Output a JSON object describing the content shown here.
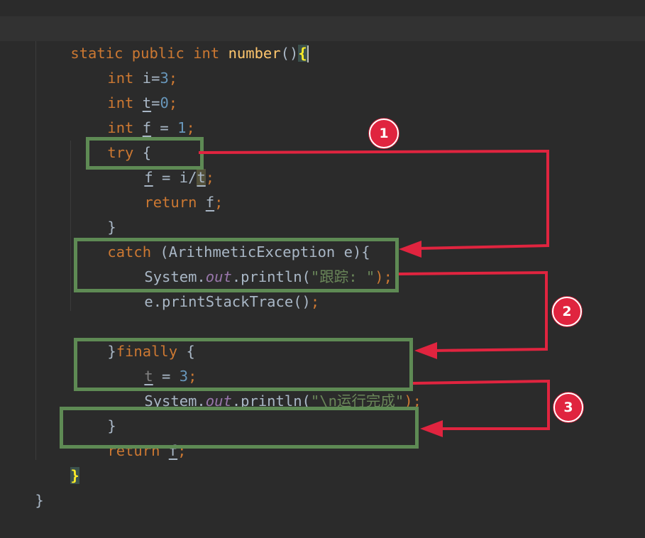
{
  "editor": {
    "language": "java",
    "lines": [
      {
        "parts": [
          "static",
          "public",
          "int",
          "number",
          "()",
          "{"
        ]
      },
      {
        "parts": [
          "int",
          "i=",
          "3",
          ";"
        ]
      },
      {
        "parts": [
          "int",
          "t",
          "=",
          "0",
          ";"
        ]
      },
      {
        "parts": [
          "int",
          "f",
          " = ",
          "1",
          ";"
        ]
      },
      {
        "parts": [
          "try",
          " {"
        ]
      },
      {
        "parts": [
          "f",
          " = i/",
          "t",
          ";"
        ]
      },
      {
        "parts": [
          "return",
          "f",
          ";"
        ]
      },
      {
        "parts": [
          "}"
        ]
      },
      {
        "parts": [
          "catch",
          " (ArithmeticException e){"
        ]
      },
      {
        "parts": [
          "System.",
          "out",
          ".println(",
          "\"跟踪: \"",
          ");"
        ]
      },
      {
        "parts": [
          "e.printStackTrace()",
          ";"
        ]
      },
      {
        "parts": [
          "}",
          "finally",
          " {"
        ]
      },
      {
        "parts": [
          "t",
          " = ",
          "3",
          ";"
        ]
      },
      {
        "parts": [
          "System.",
          "out",
          ".println(",
          "\"\\n运行完成\"",
          ");"
        ]
      },
      {
        "parts": [
          "}"
        ]
      },
      {
        "parts": [
          "return",
          "f",
          ";"
        ]
      },
      {
        "parts": [
          "}"
        ]
      },
      {
        "parts": [
          "}"
        ]
      }
    ]
  },
  "annotations": {
    "badges": [
      "1",
      "2",
      "3"
    ],
    "box_color": "#5e8a54",
    "arrow_color": "#e0243f"
  }
}
